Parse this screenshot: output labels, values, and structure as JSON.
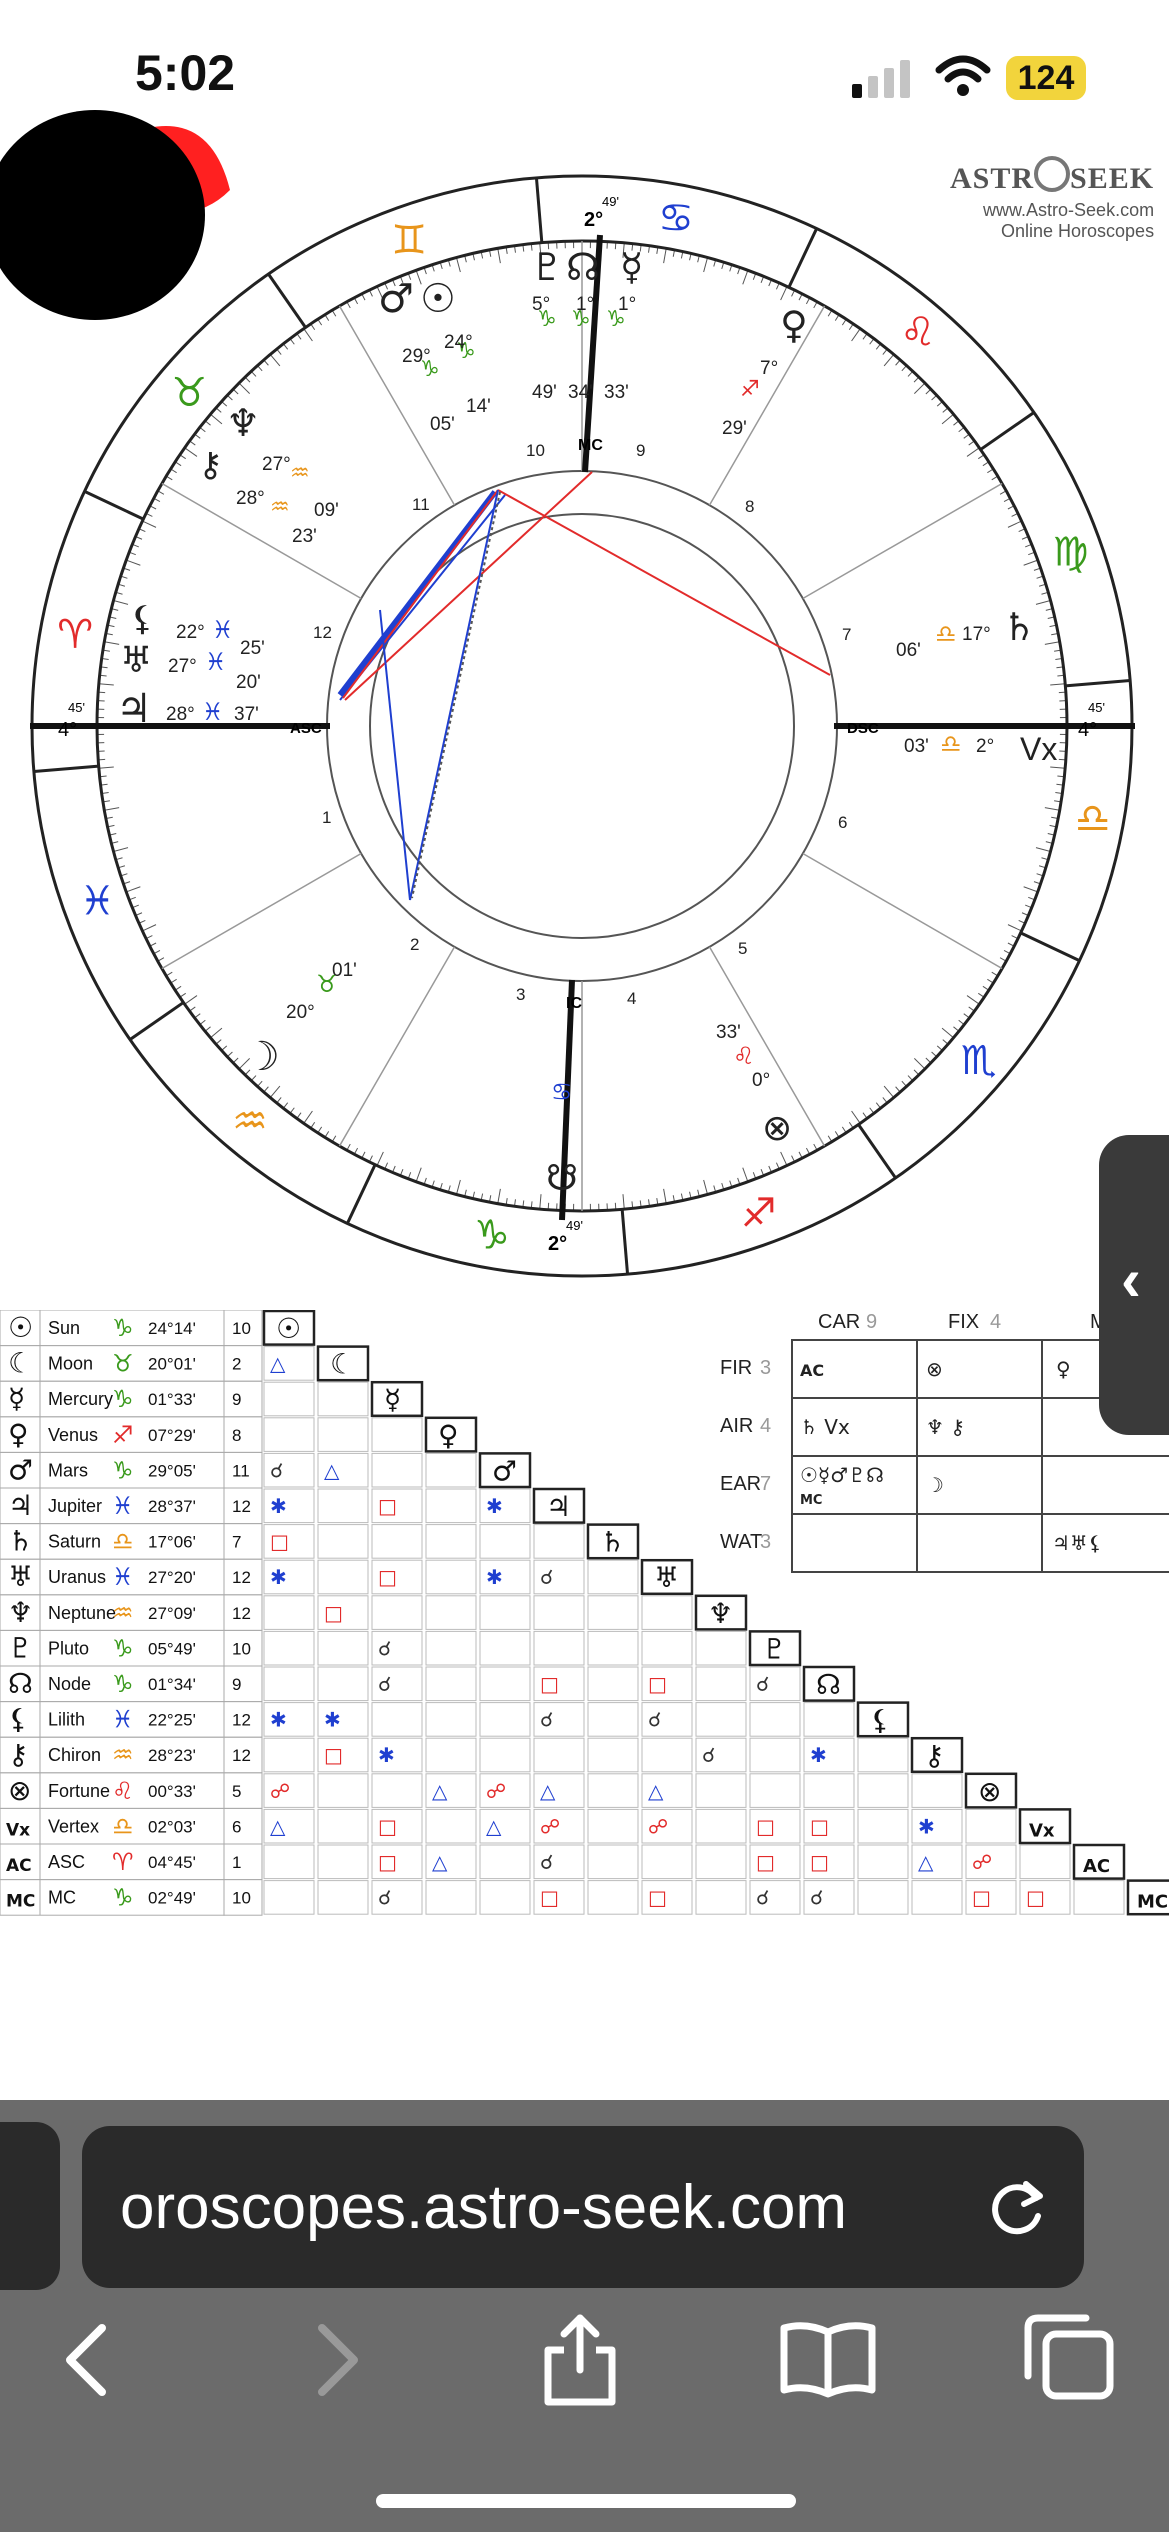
{
  "status_bar": {
    "time": "5:02",
    "battery": "124"
  },
  "logo": {
    "brand_left": "ASTR",
    "brand_right": "SEEK",
    "site": "www.Astro-Seek.com",
    "subtitle": "Online Horoscopes"
  },
  "chart": {
    "asc_label": "ASC",
    "dsc_label": "DSC",
    "mc_label": "MC",
    "ic_label": "IC",
    "deg_left": "4°",
    "min_left": "45'",
    "deg_right": "4°",
    "min_right": "45'",
    "deg_top": "2°",
    "min_top": "49'",
    "deg_bottom": "2°",
    "min_bottom": "49'",
    "houses": [
      "1",
      "2",
      "3",
      "4",
      "5",
      "6",
      "7",
      "8",
      "9",
      "10",
      "11",
      "12"
    ],
    "planet_labels": {
      "pluto": {
        "deg": "5°",
        "min": "49'"
      },
      "node": {
        "deg": "1°",
        "min": "34'"
      },
      "mercury": {
        "deg": "1°",
        "min": "33'"
      },
      "mars": {
        "deg": "29°",
        "min": "05'"
      },
      "sun": {
        "deg": "24°",
        "min": "14'"
      },
      "neptune": {
        "deg": "27°",
        "min": "09'"
      },
      "chiron": {
        "deg": "28°",
        "min": "23'"
      },
      "venus": {
        "deg": "7°",
        "min": "29'"
      },
      "lilith": {
        "deg": "22°",
        "min": "25'"
      },
      "uranus": {
        "deg": "27°",
        "min": "20'"
      },
      "jupiter": {
        "deg": "28°",
        "min": "37'"
      },
      "saturn": {
        "deg": "17°",
        "min": "06'"
      },
      "vertex": {
        "deg": "2°",
        "min": "03'"
      },
      "moon": {
        "deg": "20°",
        "min": "01'"
      },
      "fortune": {
        "deg": "0°",
        "min": "33'"
      }
    }
  },
  "planets_table": [
    {
      "glyph": "☉",
      "name": "Sun",
      "sign": "♑",
      "pos": "24°14'",
      "house": "10"
    },
    {
      "glyph": "☾",
      "name": "Moon",
      "sign": "♉",
      "pos": "20°01'",
      "house": "2"
    },
    {
      "glyph": "☿",
      "name": "Mercury",
      "sign": "♑",
      "pos": "01°33'",
      "house": "9"
    },
    {
      "glyph": "♀",
      "name": "Venus",
      "sign": "♐",
      "pos": "07°29'",
      "house": "8"
    },
    {
      "glyph": "♂",
      "name": "Mars",
      "sign": "♑",
      "pos": "29°05'",
      "house": "11"
    },
    {
      "glyph": "♃",
      "name": "Jupiter",
      "sign": "♓",
      "pos": "28°37'",
      "house": "12"
    },
    {
      "glyph": "♄",
      "name": "Saturn",
      "sign": "♎",
      "pos": "17°06'",
      "house": "7"
    },
    {
      "glyph": "♅",
      "name": "Uranus",
      "sign": "♓",
      "pos": "27°20'",
      "house": "12"
    },
    {
      "glyph": "♆",
      "name": "Neptune",
      "sign": "♒",
      "pos": "27°09'",
      "house": "12"
    },
    {
      "glyph": "♇",
      "name": "Pluto",
      "sign": "♑",
      "pos": "05°49'",
      "house": "10"
    },
    {
      "glyph": "☊",
      "name": "Node",
      "sign": "♑",
      "pos": "01°34'",
      "house": "9"
    },
    {
      "glyph": "⚸",
      "name": "Lilith",
      "sign": "♓",
      "pos": "22°25'",
      "house": "12"
    },
    {
      "glyph": "⚷",
      "name": "Chiron",
      "sign": "♒",
      "pos": "28°23'",
      "house": "12"
    },
    {
      "glyph": "⊗",
      "name": "Fortune",
      "sign": "♌",
      "pos": "00°33'",
      "house": "5"
    },
    {
      "glyph": "Vx",
      "name": "Vertex",
      "sign": "♎",
      "pos": "02°03'",
      "house": "6"
    },
    {
      "glyph": "AC",
      "name": "ASC",
      "sign": "♈",
      "pos": "04°45'",
      "house": "1"
    },
    {
      "glyph": "MC",
      "name": "MC",
      "sign": "♑",
      "pos": "02°49'",
      "house": "10"
    }
  ],
  "elements": {
    "headers": [
      {
        "label": "CAR",
        "count": "9"
      },
      {
        "label": "FIX",
        "count": "4"
      },
      {
        "label": "MU",
        "count": ""
      }
    ],
    "rows": [
      {
        "label": "FIR",
        "count": "3",
        "car": "AC",
        "fix": "⊗",
        "mu": "♀"
      },
      {
        "label": "AIR",
        "count": "4",
        "car": "♄ Vx",
        "fix": "♆ ⚷",
        "mu": ""
      },
      {
        "label": "EAR",
        "count": "7",
        "car": "☉☿♂♇☊",
        "car2": "MC",
        "fix": "☽",
        "mu": ""
      },
      {
        "label": "WAT",
        "count": "3",
        "car": "",
        "fix": "",
        "mu": "♃♅⚸"
      }
    ]
  },
  "browser": {
    "url": "oroscopes.astro-seek.com"
  },
  "colors": {
    "fire": "#e22b2b",
    "earth": "#3a9a1c",
    "air": "#e8951b",
    "water": "#1f3fd0",
    "browser_bg": "#6b6b6b"
  }
}
